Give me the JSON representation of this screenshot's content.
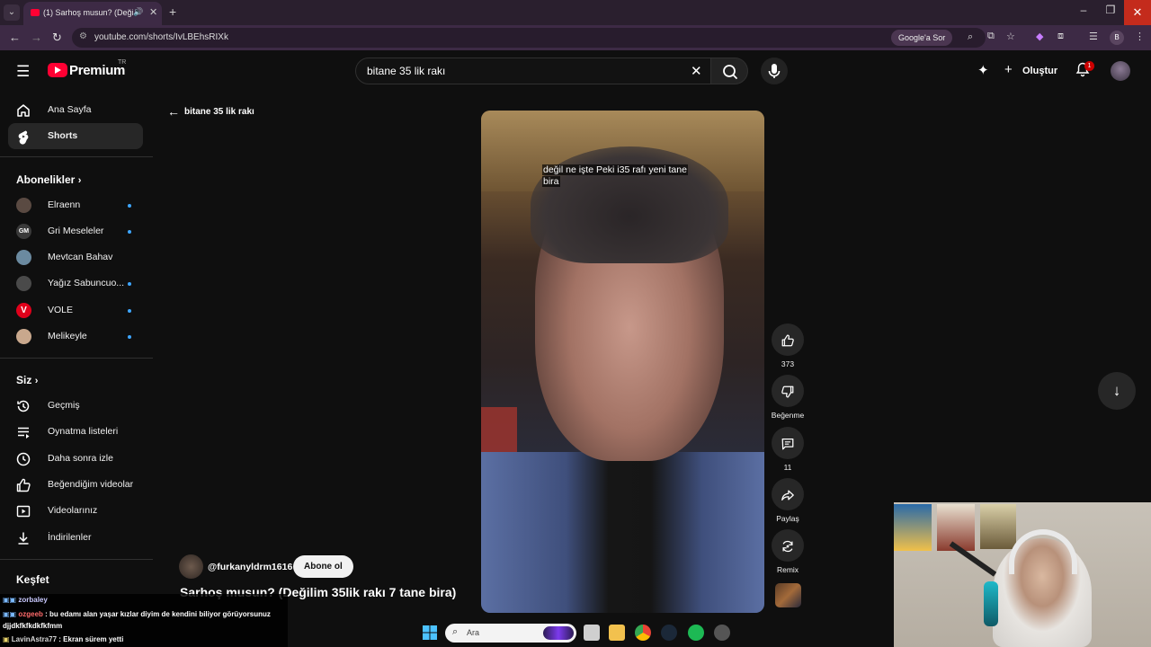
{
  "browser": {
    "tab_title": "(1) Sarhoş musun? (Değilim",
    "url": "youtube.com/shorts/IvLBEhsRIXk",
    "ask_google": "Google'a Sor",
    "profile_letter": "B"
  },
  "header": {
    "logo_text": "Premium",
    "logo_region": "TR",
    "search_query": "bitane 35 lik rakı",
    "create_label": "Oluştur",
    "notification_count": "1"
  },
  "sidebar": {
    "main": [
      {
        "label": "Ana Sayfa",
        "icon": "home-icon"
      },
      {
        "label": "Shorts",
        "icon": "shorts-icon",
        "active": true
      }
    ],
    "subscriptions_title": "Abonelikler",
    "subscriptions": [
      {
        "label": "Elraenn",
        "avatar_color": "#5a4a42",
        "new": true
      },
      {
        "label": "Gri Meseleler",
        "avatar_text": "GM",
        "avatar_color": "#3a3a3a",
        "new": true
      },
      {
        "label": "Mevtcan Bahav",
        "avatar_color": "#6b8aa0",
        "new": false
      },
      {
        "label": "Yağız Sabuncuo...",
        "avatar_color": "#4a4a4a",
        "new": true
      },
      {
        "label": "VOLE",
        "avatar_text": "V",
        "avatar_color": "#e0001b",
        "new": true
      },
      {
        "label": "Melikeyle",
        "avatar_color": "#c9a88d",
        "new": true
      }
    ],
    "you_title": "Siz",
    "you": [
      {
        "label": "Geçmiş",
        "icon": "history-icon"
      },
      {
        "label": "Oynatma listeleri",
        "icon": "playlists-icon"
      },
      {
        "label": "Daha sonra izle",
        "icon": "watch-later-icon"
      },
      {
        "label": "Beğendiğim videolar",
        "icon": "liked-icon"
      },
      {
        "label": "Videolarınız",
        "icon": "your-videos-icon"
      },
      {
        "label": "İndirilenler",
        "icon": "downloads-icon"
      }
    ],
    "explore_title": "Keşfet"
  },
  "content": {
    "back_label": "bitane 35 lik rakı",
    "caption_line1": "değil ne işte Peki i35 rafı yeni tane",
    "caption_line2": "bira",
    "channel_handle": "@furkanyldrm1616",
    "subscribe_label": "Abone ol",
    "title": "Sarhoş musun? (Değilim 35lik rakı 7 tane bira)"
  },
  "actions": {
    "like_count": "373",
    "dislike_label": "Beğenme",
    "comment_count": "11",
    "share_label": "Paylaş",
    "remix_label": "Remix"
  },
  "chat": {
    "line1_user": "zorbaley",
    "line2_user": "ozgeeb",
    "line2_msg": " : bu edamı alan yaşar kızlar diyim de kendini biliyor görüyorsunuz",
    "line2_cont": "djjdkfkfkdkfkfmm",
    "line3_user": "LavinAstra77",
    "line3_msg": " : Ekran sürem yetti"
  },
  "taskbar": {
    "search_placeholder": "Ara"
  }
}
